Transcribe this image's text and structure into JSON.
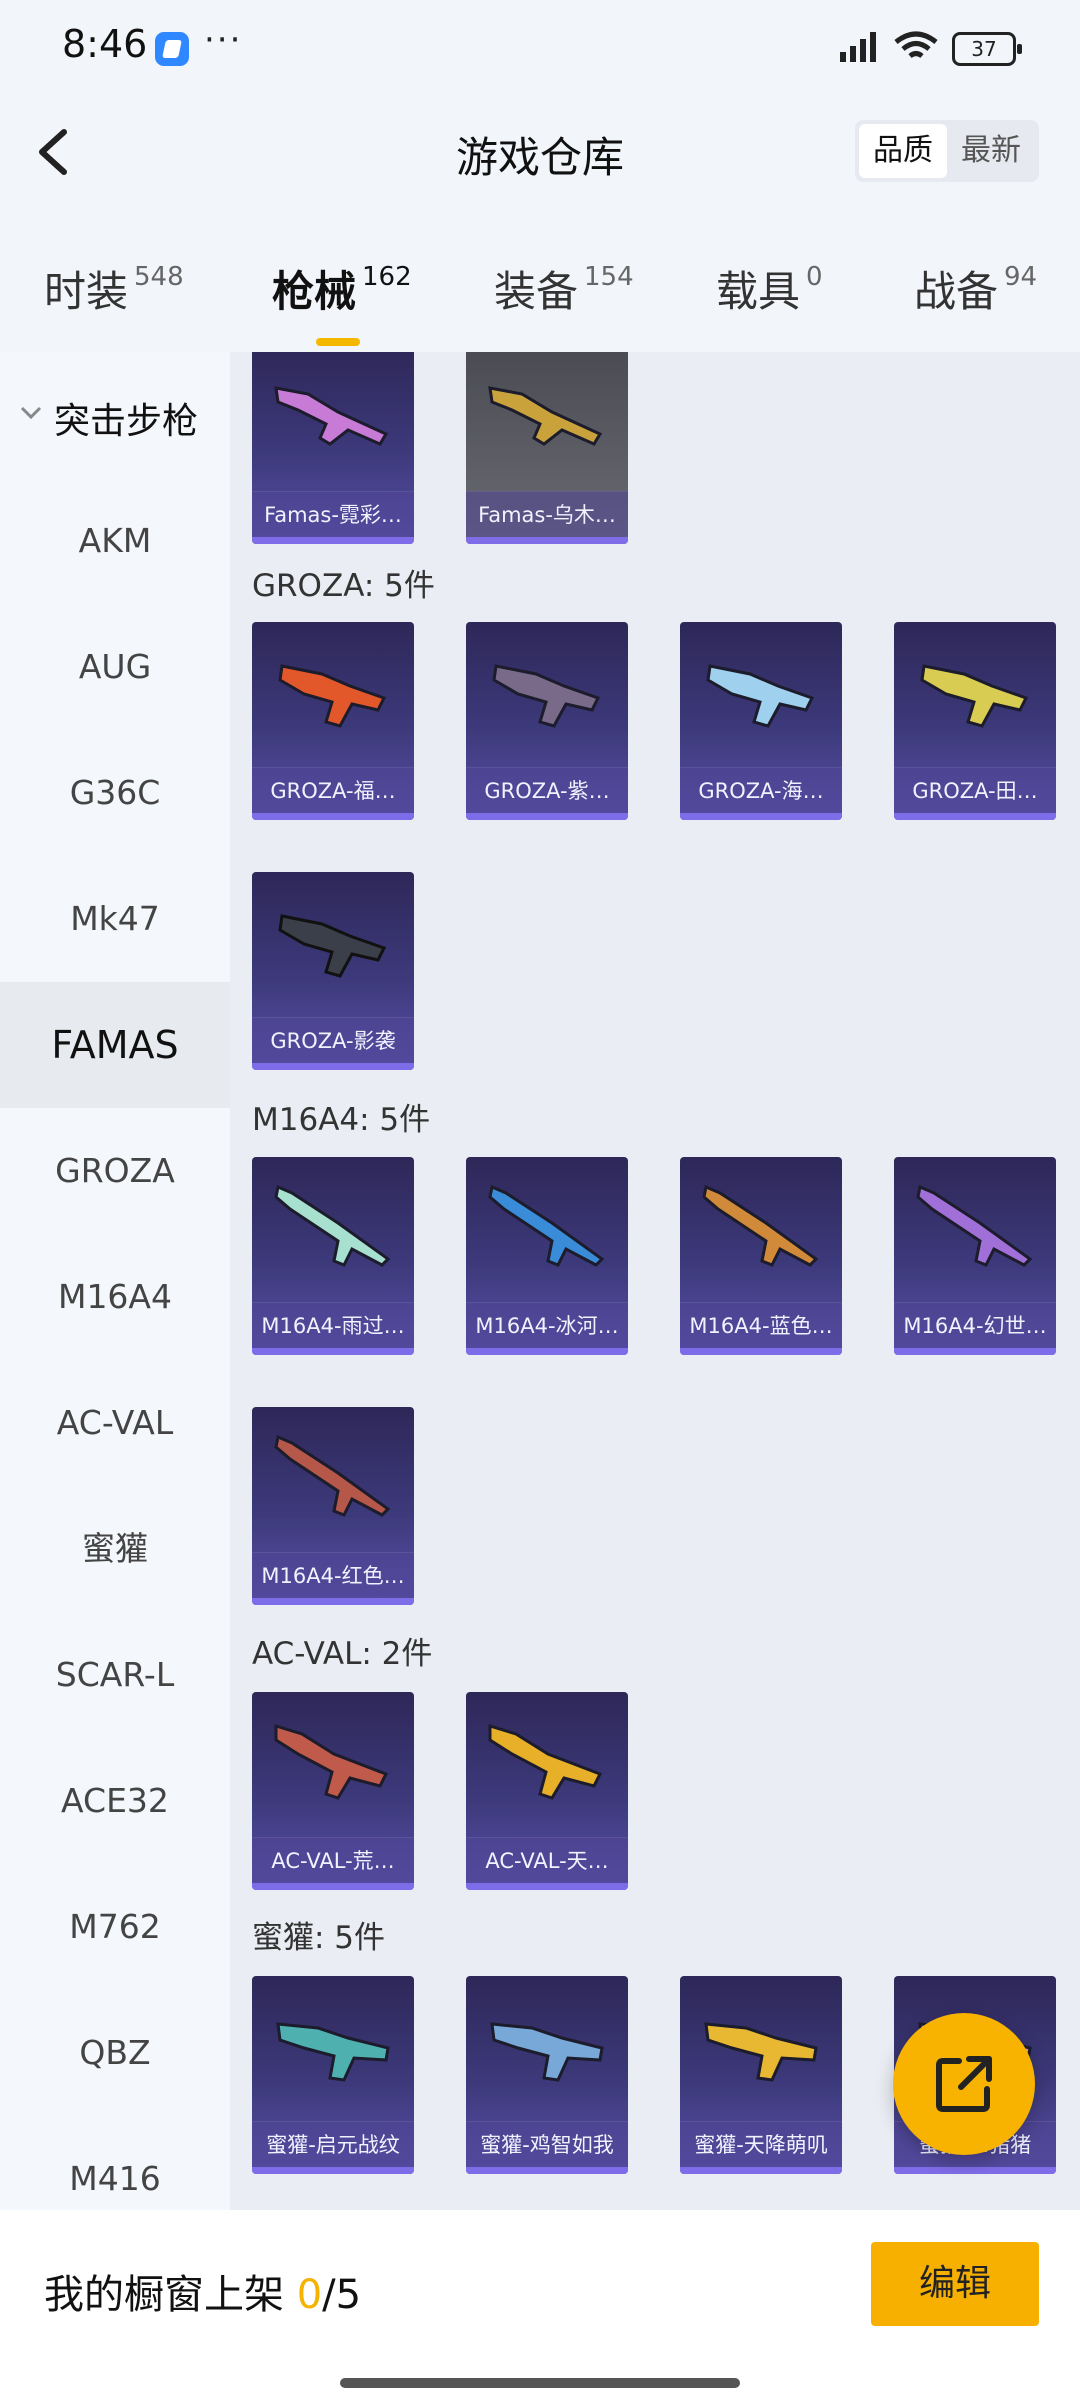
{
  "status_bar": {
    "time": "8:46",
    "dots": "···",
    "battery": "37"
  },
  "header": {
    "title": "游戏仓库",
    "sort": {
      "quality": "品质",
      "latest": "最新"
    }
  },
  "tabs": [
    {
      "label": "时装",
      "count": "548"
    },
    {
      "label": "枪械",
      "count": "162",
      "active": true
    },
    {
      "label": "装备",
      "count": "154"
    },
    {
      "label": "载具",
      "count": "0"
    },
    {
      "label": "战备",
      "count": "94"
    }
  ],
  "sidebar": {
    "category": "突击步枪",
    "items": [
      "AKM",
      "AUG",
      "G36C",
      "Mk47",
      "FAMAS",
      "GROZA",
      "M16A4",
      "AC-VAL",
      "蜜獾",
      "SCAR-L",
      "ACE32",
      "M762",
      "QBZ",
      "M416"
    ],
    "active": "FAMAS"
  },
  "groups": [
    {
      "title": "",
      "items": [
        "Famas-霓彩…",
        "Famas-乌木…"
      ]
    },
    {
      "title": "GROZA: 5件",
      "items": [
        "GROZA-福…",
        "GROZA-紫…",
        "GROZA-海…",
        "GROZA-田…",
        "GROZA-影袭"
      ]
    },
    {
      "title": "M16A4: 5件",
      "items": [
        "M16A4-雨过…",
        "M16A4-冰河…",
        "M16A4-蓝色…",
        "M16A4-幻世…",
        "M16A4-红色…"
      ]
    },
    {
      "title": "AC-VAL: 2件",
      "items": [
        "AC-VAL-荒…",
        "AC-VAL-天…"
      ]
    },
    {
      "title": "蜜獾: 5件",
      "items": [
        "蜜獾-启元战纹",
        "蜜獾-鸡智如我",
        "蜜獾-天降萌叽",
        "蜜獾-…猪猪"
      ]
    }
  ],
  "bottom": {
    "label": "我的橱窗上架 ",
    "current": "0",
    "total": "/5",
    "edit": "编辑"
  },
  "colors": {
    "accent": "#f7b000",
    "card": "#3d3a7c",
    "card_bar": "#7f6ce8"
  }
}
